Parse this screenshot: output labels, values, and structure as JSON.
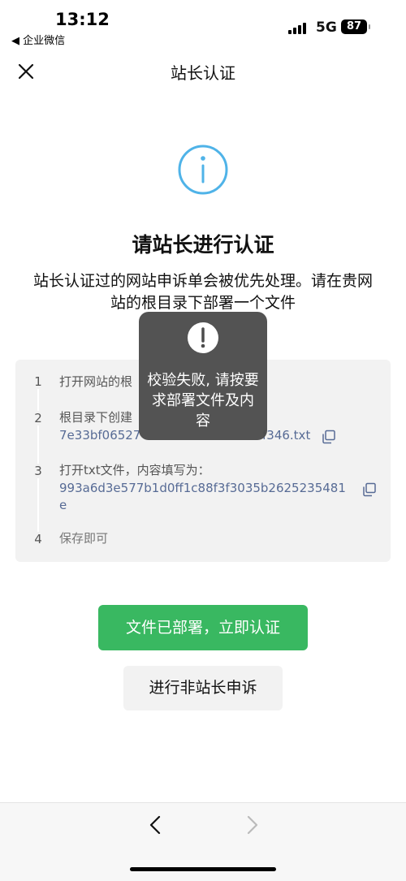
{
  "status_bar": {
    "time": "13:12",
    "back_app": "◀ 企业微信",
    "network": "5G",
    "battery": "87"
  },
  "header": {
    "title": "站长认证",
    "close_icon": "close-icon"
  },
  "main": {
    "icon": "info-circle-icon",
    "title": "请站长进行认证",
    "description": "站长认证过的网站申诉单会被优先处理。请在贵网站的根目录下部署一个文件"
  },
  "steps": [
    {
      "num": "1",
      "text": "打开网站的根"
    },
    {
      "num": "2",
      "text": "根目录下创建",
      "link": "7e33bf06527",
      "link_tail": "f346.txt"
    },
    {
      "num": "3",
      "text": "打开txt文件，内容填写为：",
      "link": "993a6d3e577b1d0ff1c88f3f3035b2625235481e"
    },
    {
      "num": "4",
      "text": "保存即可"
    }
  ],
  "buttons": {
    "primary": "文件已部署，立即认证",
    "secondary": "进行非站长申诉"
  },
  "toast": {
    "icon": "exclamation-circle-icon",
    "message": "校验失败, 请按要求部署文件及内容"
  },
  "colors": {
    "accent_green": "#39b861",
    "link_blue": "#576b95",
    "info_blue": "#4fb3e8",
    "toast_bg": "#4c4c4c"
  }
}
